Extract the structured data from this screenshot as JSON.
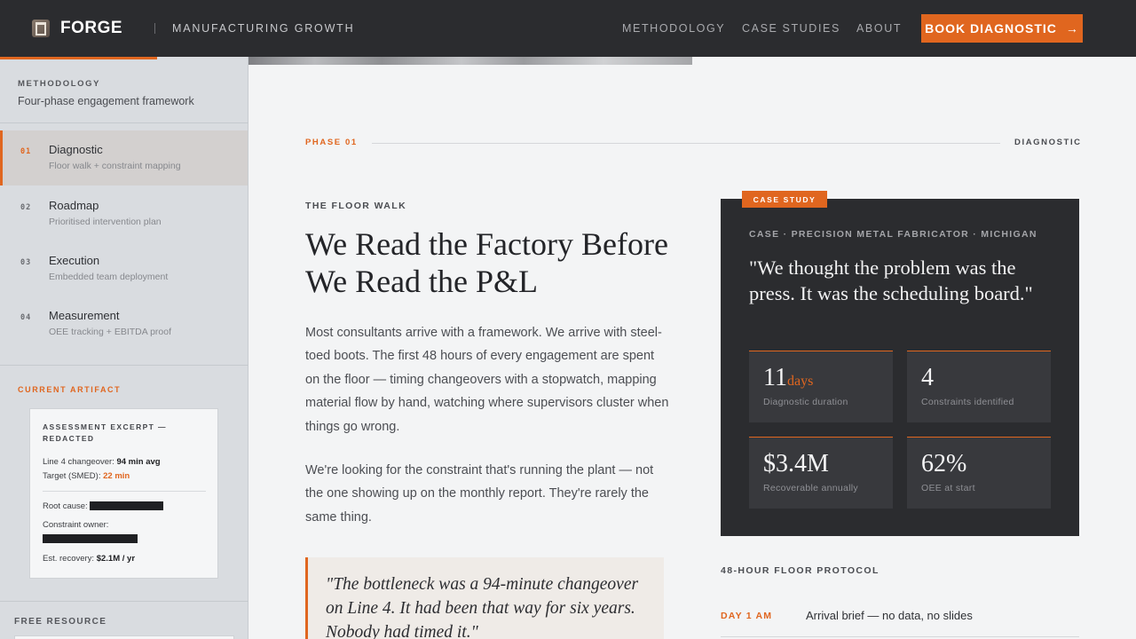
{
  "header": {
    "brand": "FORGE",
    "tagline": "MANUFACTURING GROWTH",
    "nav": [
      "METHODOLOGY",
      "CASE STUDIES",
      "ABOUT"
    ],
    "cta_label": "BOOK DIAGNOSTIC",
    "cta_arrow": "→",
    "accent_color": "#e0661f"
  },
  "sidebar": {
    "kicker": "METHODOLOGY",
    "subtitle": "Four-phase engagement framework",
    "phases": [
      {
        "num": "01",
        "title": "Diagnostic",
        "desc": "Floor walk + constraint mapping",
        "active": true
      },
      {
        "num": "02",
        "title": "Roadmap",
        "desc": "Prioritised intervention plan"
      },
      {
        "num": "03",
        "title": "Execution",
        "desc": "Embedded team deployment"
      },
      {
        "num": "04",
        "title": "Measurement",
        "desc": "OEE tracking + EBITDA proof"
      }
    ],
    "artifact": {
      "kicker": "CURRENT ARTIFACT",
      "title": "ASSESSMENT EXCERPT — REDACTED",
      "changeover_label": "Line 4 changeover:",
      "changeover_value": "94 min avg",
      "target_label": "Target (SMED):",
      "target_value": "22 min",
      "root_cause_label": "Root cause:",
      "owner_label": "Constraint owner:",
      "recovery_label": "Est. recovery:",
      "recovery_value": "$2.1M / yr"
    },
    "free_resource": "FREE RESOURCE"
  },
  "main": {
    "phase_label": "PHASE 01",
    "phase_name": "DIAGNOSTIC",
    "kicker": "THE FLOOR WALK",
    "headline": "We Read the Factory Before We Read the P&L",
    "para1": "Most consultants arrive with a framework. We arrive with steel-toed boots. The first 48 hours of every engagement are spent on the floor — timing changeovers with a stopwatch, mapping material flow by hand, watching where supervisors cluster when things go wrong.",
    "para2": "We're looking for the constraint that's running the plant — not the one showing up on the monthly report. They're rarely the same thing.",
    "pull_quote": "\"The bottleneck was a 94-minute changeover on Line 4. It had been that way for six years. Nobody had timed it.\""
  },
  "case_study": {
    "badge": "CASE STUDY",
    "meta": "CASE · PRECISION METAL FABRICATOR · MICHIGAN",
    "quote": "\"We thought the problem was the press. It was the scheduling board.\"",
    "stats": [
      {
        "value": "11",
        "unit": "days",
        "label": "Diagnostic duration"
      },
      {
        "value": "4",
        "unit": "",
        "label": "Constraints identified"
      },
      {
        "value": "$3.4M",
        "unit": "",
        "label": "Recoverable annually"
      },
      {
        "value": "62%",
        "unit": "",
        "label": "OEE at start"
      }
    ]
  },
  "protocol": {
    "kicker": "48-HOUR FLOOR PROTOCOL",
    "items": [
      {
        "day": "DAY 1 AM",
        "text": "Arrival brief — no data, no slides"
      }
    ]
  }
}
